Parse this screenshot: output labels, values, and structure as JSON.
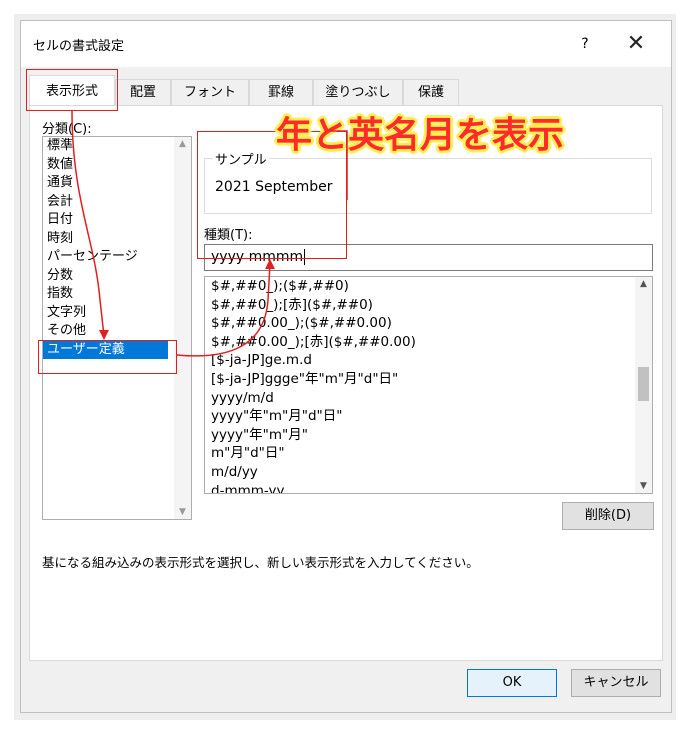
{
  "window": {
    "title": "セルの書式設定",
    "help": "?",
    "close_icon": "close-icon"
  },
  "tabs": [
    {
      "label": "表示形式",
      "active": true
    },
    {
      "label": "配置"
    },
    {
      "label": "フォント"
    },
    {
      "label": "罫線"
    },
    {
      "label": "塗りつぶし"
    },
    {
      "label": "保護"
    }
  ],
  "category": {
    "label": "分類(C):",
    "items": [
      "標準",
      "数値",
      "通貨",
      "会計",
      "日付",
      "時刻",
      "パーセンテージ",
      "分数",
      "指数",
      "文字列",
      "その他",
      "ユーザー定義"
    ],
    "selected": "ユーザー定義"
  },
  "sample": {
    "legend": "サンプル",
    "value": "2021 September"
  },
  "type": {
    "label": "種類(T):",
    "value": "yyyy mmmm",
    "list": [
      "$#,##0_);($#,##0)",
      "$#,##0_);[赤]($#,##0)",
      "$#,##0.00_);($#,##0.00)",
      "$#,##0.00_);[赤]($#,##0.00)",
      "[$-ja-JP]ge.m.d",
      "[$-ja-JP]ggge\"年\"m\"月\"d\"日\"",
      "yyyy/m/d",
      "yyyy\"年\"m\"月\"d\"日\"",
      "yyyy\"年\"m\"月\"",
      "m\"月\"d\"日\"",
      "m/d/yy",
      "d-mmm-yy"
    ]
  },
  "buttons": {
    "delete": "削除(D)",
    "ok": "OK",
    "cancel": "キャンセル"
  },
  "description": "基になる組み込みの表示形式を選択し、新しい表示形式を入力してください。",
  "annotation": {
    "text": "年と英名月を表示",
    "color": "#ff2a2a",
    "outline_color": "#ffee55"
  },
  "colors": {
    "selection": "#0078d7",
    "highlight_box": "#e02020"
  }
}
